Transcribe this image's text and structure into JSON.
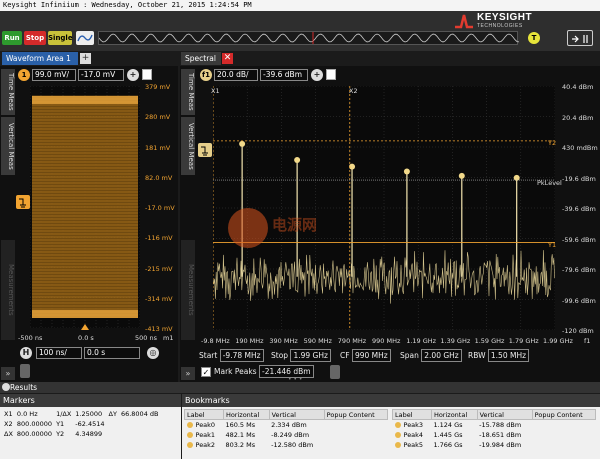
{
  "window": {
    "title": "Keysight Infiniium : Wednesday, October 21, 2015 1:24:54 PM"
  },
  "brand": {
    "name": "KEYSIGHT",
    "sub": "TECHNOLOGIES"
  },
  "controls": {
    "run": "Run",
    "stop": "Stop",
    "single": "Single",
    "trigger": "T",
    "colors": {
      "run": "#2e9a2e",
      "stop": "#d42a2a",
      "single": "#c9c23a",
      "accent": "#f2a431"
    }
  },
  "tabs": {
    "waveform": "Waveform Area 1",
    "spectral": "Spectral"
  },
  "side_tabs": {
    "time_meas": "Time Meas",
    "vertical_meas": "Vertical Meas",
    "measurements": "Measurements"
  },
  "waveform": {
    "scale": "99.0 mV/",
    "offset": "-17.0 mV",
    "y_ticks": [
      "379 mV",
      "280 mV",
      "181 mV",
      "82.0 mV",
      "-17.0 mV",
      "-116 mV",
      "-215 mV",
      "-314 mV",
      "-413 mV"
    ],
    "x_ticks": [
      "-500 ns",
      "0.0 s",
      "500 ns"
    ],
    "marker_label": "m1",
    "h_scale": "100 ns/",
    "h_delay": "0.0 s",
    "h_icon": "H"
  },
  "spectral": {
    "scale": "20.0 dB/",
    "offset": "-39.6 dBm",
    "y_ticks": [
      "40.4 dBm",
      "20.4 dBm",
      "430 mdBm",
      "-19.6 dBm",
      "-39.6 dBm",
      "-59.6 dBm",
      "-79.6 dBm",
      "-99.6 dBm",
      "-120 dBm"
    ],
    "x_ticks": [
      "-9.8 MHz",
      "190 MHz",
      "390 MHz",
      "590 MHz",
      "790 MHz",
      "990 MHz",
      "1.19 GHz",
      "1.39 GHz",
      "1.59 GHz",
      "1.79 GHz",
      "1.99 GHz"
    ],
    "marker_x1": "X1",
    "marker_x2": "X2",
    "marker_y1": "Y1",
    "marker_y2": "Y2",
    "pk_level": "PkLevel",
    "f_marker": "f1",
    "start_label": "Start",
    "start_value": "-9.78 MHz",
    "stop_label": "Stop",
    "stop_value": "1.99 GHz",
    "cf_label": "CF",
    "cf_value": "990 MHz",
    "span_label": "Span",
    "span_value": "2.00 GHz",
    "rbw_label": "RBW",
    "rbw_value": "1.50 MHz",
    "mark_peaks": "Mark Peaks",
    "mark_peaks_value": "-21.446 dBm",
    "peaks": [
      {
        "mhz": 160.5,
        "dbm": 2.334
      },
      {
        "mhz": 482.1,
        "dbm": -8.249
      },
      {
        "mhz": 803.2,
        "dbm": -12.58
      },
      {
        "mhz": 1124,
        "dbm": -15.788
      },
      {
        "mhz": 1445,
        "dbm": -18.651
      },
      {
        "mhz": 1766,
        "dbm": -19.984
      }
    ]
  },
  "results": {
    "title": "Results"
  },
  "markers": {
    "title": "Markers",
    "rows": [
      [
        "X1",
        "0.0 Hz",
        "1/ΔX",
        "1.25000",
        "ΔY",
        "66.8004 dB"
      ],
      [
        "X2",
        "800.00000",
        "Y1",
        "-62.4514",
        "",
        ""
      ],
      [
        "ΔX",
        "800.00000",
        "Y2",
        "4.34899",
        "",
        ""
      ]
    ]
  },
  "bookmarks": {
    "title": "Bookmarks",
    "columns": [
      "Label",
      "Horizontal",
      "Vertical",
      "Popup Content"
    ],
    "left_rows": [
      [
        "Peak0",
        "160.5 Ms",
        "2.334 dBm",
        ""
      ],
      [
        "Peak1",
        "482.1 Ms",
        "-8.249 dBm",
        ""
      ],
      [
        "Peak2",
        "803.2 Ms",
        "-12.580 dBm",
        ""
      ]
    ],
    "right_rows": [
      [
        "Peak3",
        "1.124 Gs",
        "-15.788 dBm",
        ""
      ],
      [
        "Peak4",
        "1.445 Gs",
        "-18.651 dBm",
        ""
      ],
      [
        "Peak5",
        "1.766 Gs",
        "-19.984 dBm",
        ""
      ]
    ]
  }
}
